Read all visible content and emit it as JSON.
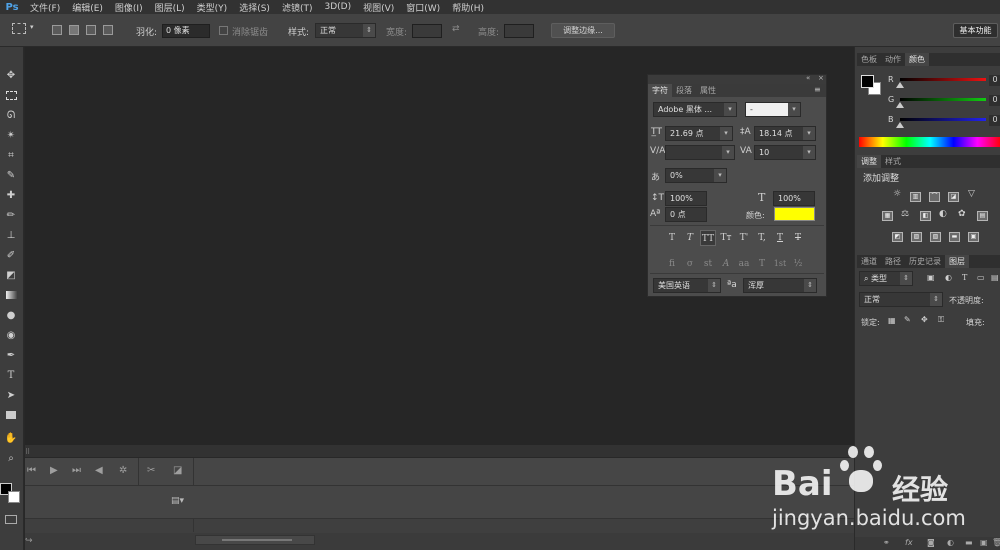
{
  "app": {
    "logo": "Ps"
  },
  "menu": [
    "文件(F)",
    "编辑(E)",
    "图像(I)",
    "图层(L)",
    "类型(Y)",
    "选择(S)",
    "滤镜(T)",
    "3D(D)",
    "视图(V)",
    "窗口(W)",
    "帮助(H)"
  ],
  "options": {
    "feather_label": "羽化:",
    "feather_value": "0 像素",
    "antialias_label": "消除锯齿",
    "style_label": "样式:",
    "style_value": "正常",
    "width_label": "宽度:",
    "height_label": "高度:",
    "refine_button": "调整边缘...",
    "workspace_button": "基本功能"
  },
  "char_panel": {
    "tabs": [
      "字符",
      "段落",
      "属性"
    ],
    "font_family": "Adobe 黑体 ...",
    "font_style": "-",
    "font_size": "21.69 点",
    "leading": "18.14 点",
    "kerning": "",
    "tracking": "10",
    "tsume": "0%",
    "vscale": "100%",
    "hscale": "100%",
    "baseline": "0 点",
    "color_label": "颜色:",
    "text_color": "#ffff00",
    "type_buttons": [
      "T",
      "T",
      "TT",
      "Tт",
      "T'",
      "T,",
      "T",
      "T"
    ],
    "ot_buttons": [
      "fi",
      "σ",
      "st",
      "A",
      "aa",
      "T",
      "1st",
      "½"
    ],
    "language": "美国英语",
    "aa_label": "ªa",
    "antialias": "浑厚"
  },
  "color_panel": {
    "tabs": [
      "色板",
      "动作",
      "颜色"
    ],
    "channels": [
      {
        "label": "R",
        "value": "0"
      },
      {
        "label": "G",
        "value": "0"
      },
      {
        "label": "B",
        "value": "0"
      }
    ]
  },
  "adjust_panel": {
    "tabs": [
      "调整",
      "样式"
    ],
    "title": "添加调整"
  },
  "layers_panel": {
    "tabs": [
      "通道",
      "路径",
      "历史记录",
      "图层"
    ],
    "kind": "类型",
    "blend": "正常",
    "opacity_label": "不透明度:",
    "lock_label": "锁定:",
    "fill_label": "填充:"
  },
  "watermark": {
    "logo_text": "Bai",
    "logo_text2": "经验",
    "url": "jingyan.baidu.com"
  }
}
